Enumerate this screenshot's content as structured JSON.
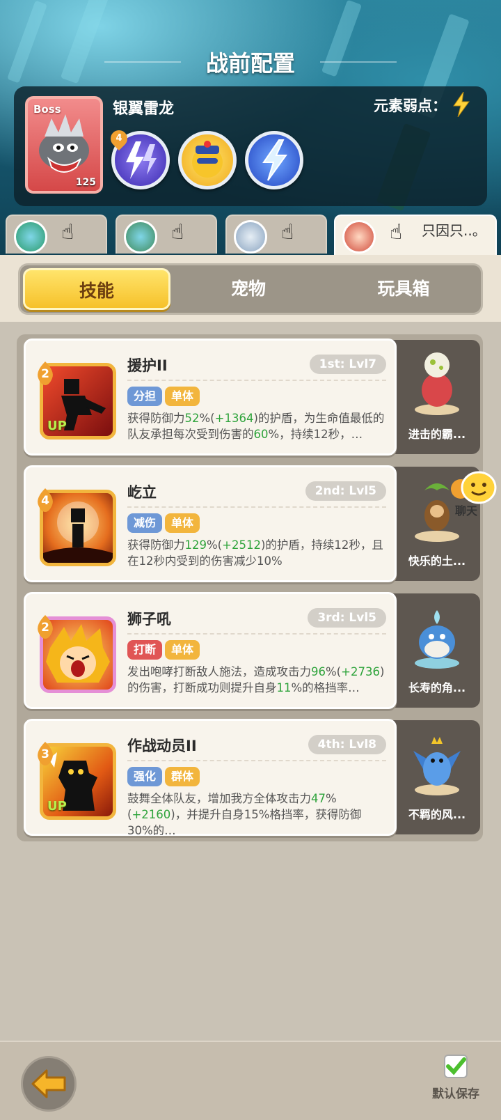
{
  "screen_title": "战前配置",
  "boss": {
    "tag": "Boss",
    "name": "银翼雷龙",
    "level": "125",
    "weakness_label": "元素弱点：",
    "weakness_icon": "lightning-icon",
    "skills": [
      {
        "badge": "4",
        "icon": "double-lightning-icon"
      },
      {
        "badge": "",
        "icon": "robot-face-icon"
      },
      {
        "badge": "",
        "icon": "lightning-icon"
      }
    ]
  },
  "heroes": [
    {
      "name": "",
      "active": false
    },
    {
      "name": "",
      "active": false
    },
    {
      "name": "",
      "active": false
    },
    {
      "name": "只因只..。",
      "active": true
    }
  ],
  "tabs": [
    "技能",
    "宠物",
    "玩具箱"
  ],
  "active_tab": 0,
  "skills": [
    {
      "name": "援护II",
      "slot": "1st: Lvl7",
      "level": "2",
      "up": "UP",
      "tags": [
        "分担",
        "单体"
      ],
      "desc_parts": [
        "获得防御力",
        "52",
        "%(",
        "+1364",
        ")的护盾，为生命值最低的队友承担每次受到伤害的",
        "60",
        "%，持续12秒，…"
      ],
      "pet": "进击的霸..."
    },
    {
      "name": "屹立",
      "slot": "2nd: Lvl5",
      "level": "4",
      "up": "",
      "tags": [
        "减伤",
        "单体"
      ],
      "desc_parts": [
        "获得防御力",
        "129",
        "%(",
        "+2512",
        ")的护盾，持续12秒，且在12秒内受到的伤害减少10%",
        "",
        ""
      ],
      "pet": "快乐的土..."
    },
    {
      "name": "狮子吼",
      "slot": "3rd: Lvl5",
      "level": "2",
      "up": "",
      "tags": [
        "打断",
        "单体"
      ],
      "desc_parts": [
        "发出咆哮打断敌人施法，造成攻击力",
        "96",
        "%(",
        "+2736",
        ")的伤害，打断成功则提升自身",
        "11",
        "%的格挡率…"
      ],
      "pet": "长寿的角..."
    },
    {
      "name": "作战动员II",
      "slot": "4th: Lvl8",
      "level": "3",
      "up": "UP",
      "tags": [
        "强化",
        "群体"
      ],
      "desc_parts": [
        "鼓舞全体队友，增加我方全体攻击力",
        "47",
        "%(",
        "+2160",
        ")，并提升自身15%格挡率，获得防御30%的…",
        "",
        ""
      ],
      "pet": "不羁的风..."
    }
  ],
  "chat_label": "聊天",
  "save_label": "默认保存"
}
